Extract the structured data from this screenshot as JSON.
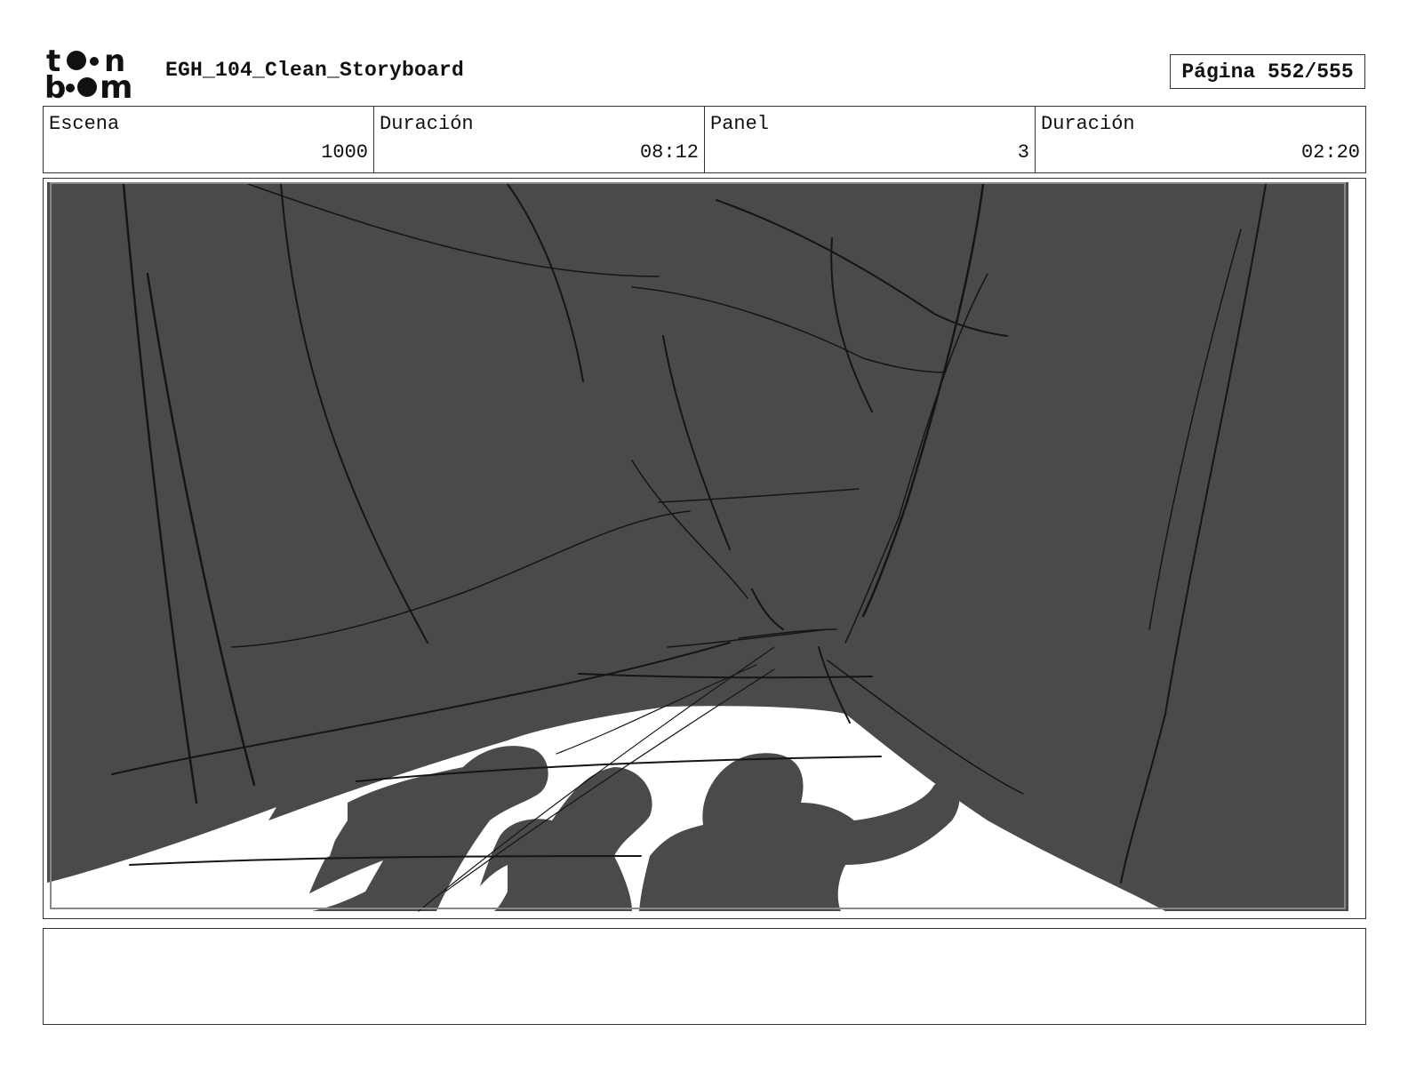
{
  "header": {
    "logo_text": [
      "t",
      "n",
      "b",
      "m"
    ],
    "title": "EGH_104_Clean_Storyboard",
    "page_label": "Página",
    "page_value": "552/555"
  },
  "info": {
    "scene_label": "Escena",
    "scene_value": "1000",
    "scene_duration_label": "Duración",
    "scene_duration_value": "08:12",
    "panel_label": "Panel",
    "panel_value": "3",
    "panel_duration_label": "Duración",
    "panel_duration_value": "02:20"
  },
  "panel": {
    "colors": {
      "shadow": "#4a4a4a",
      "line": "#151515",
      "light": "#ffffff"
    }
  },
  "notes": {
    "text": ""
  }
}
